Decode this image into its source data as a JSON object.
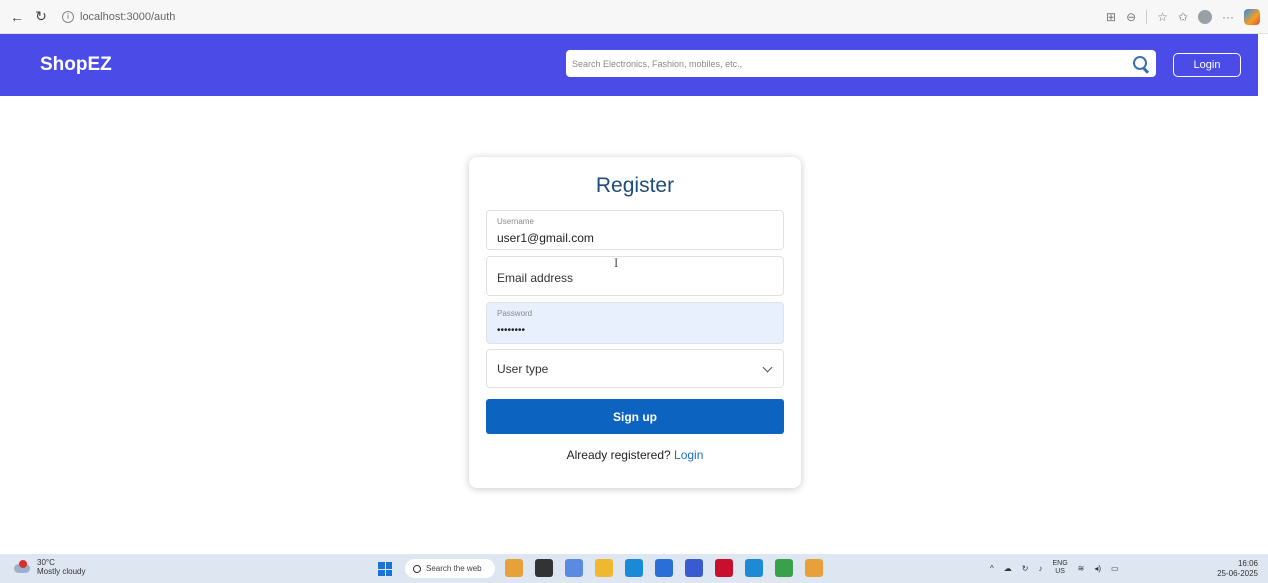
{
  "browser": {
    "back_glyph": "←",
    "reload_glyph": "↻",
    "url": "localhost:3000/auth",
    "info_glyph": "i",
    "right_glyphs": [
      "⊞",
      "⊖",
      "☆",
      "✩",
      "···"
    ]
  },
  "header": {
    "brand": "ShopEZ",
    "search_placeholder": "Search Electronics, Fashion, mobiles, etc.,",
    "login_label": "Login",
    "color": "#4b4ce8"
  },
  "form": {
    "title": "Register",
    "username": {
      "label": "Username",
      "value": "user1@gmail.com"
    },
    "email": {
      "placeholder": "Email address"
    },
    "password": {
      "label": "Password",
      "value": "••••••••"
    },
    "user_type": {
      "placeholder": "User type"
    },
    "submit_label": "Sign up",
    "already_text": "Already registered?",
    "login_link": "Login",
    "accent": "#0c64c0"
  },
  "taskbar": {
    "temperature": "30°C",
    "weather": "Mostly cloudy",
    "search_label": "Search the web",
    "apps": [
      {
        "name": "widgets-app-icon",
        "color": "#e8a13a"
      },
      {
        "name": "taskview-app-icon",
        "color": "#333333"
      },
      {
        "name": "copilot-app-icon",
        "color": "#5a8be0"
      },
      {
        "name": "files-app-icon",
        "color": "#f0b830"
      },
      {
        "name": "edge-app-icon",
        "color": "#1b8ad6"
      },
      {
        "name": "store-app-icon",
        "color": "#2a6fd8"
      },
      {
        "name": "photos-app-icon",
        "color": "#3a5bd0"
      },
      {
        "name": "mcafee-app-icon",
        "color": "#c8102e"
      },
      {
        "name": "vscode-app-icon",
        "color": "#1f8ad4"
      },
      {
        "name": "chrome-app-icon",
        "color": "#3aa14a"
      },
      {
        "name": "git-app-icon",
        "color": "#e8a13a"
      }
    ],
    "lang_top": "ENG",
    "lang_bottom": "US",
    "time": "16:06",
    "date": "25-06-2025"
  }
}
